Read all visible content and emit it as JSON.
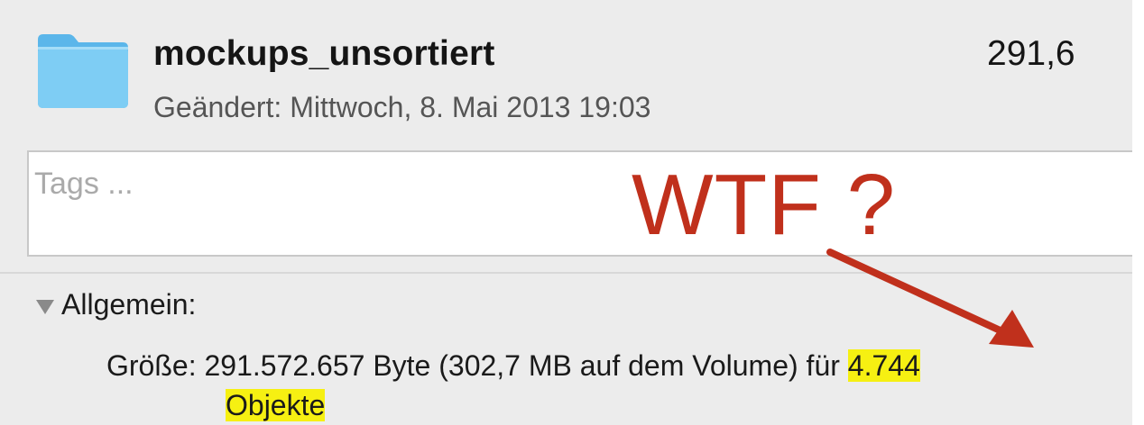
{
  "file": {
    "name": "mockups_unsortiert",
    "modified": "Geändert: Mittwoch, 8. Mai 2013 19:03",
    "size_short": "291,6",
    "icon": "folder-icon",
    "icon_color": "#6cc3f1"
  },
  "tags": {
    "placeholder": "Tags ..."
  },
  "general": {
    "section_label": "Allgemein:",
    "size_label": "Größe:",
    "size_text": "291.572.657 Byte (302,7 MB auf dem Volume) für",
    "object_count": "4.744",
    "object_word": "Objekte",
    "highlight_color": "#f6f012"
  },
  "annotation": {
    "text": "WTF ?",
    "color": "#c0301c",
    "arrow": "arrow-icon"
  }
}
